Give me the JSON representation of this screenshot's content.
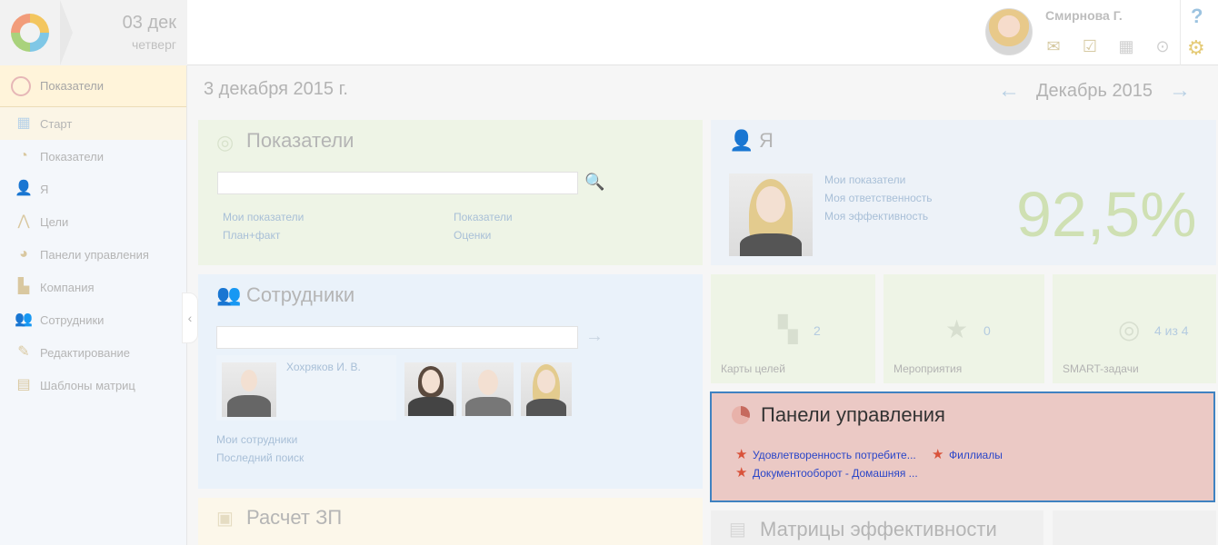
{
  "header": {
    "date_day": "03 дек",
    "date_weekday": "четверг",
    "user_name": "Смирнова Г.",
    "help_label": "?",
    "icons": [
      "mail-icon",
      "tasks-icon",
      "calendar-icon",
      "dropdown-icon"
    ]
  },
  "sidebar": {
    "section_title": "Показатели",
    "items": [
      {
        "label": "Старт",
        "icon": "grid-icon"
      },
      {
        "label": "Показатели",
        "icon": "gauge-icon"
      },
      {
        "label": "Я",
        "icon": "person-icon"
      },
      {
        "label": "Цели",
        "icon": "goals-icon"
      },
      {
        "label": "Панели управления",
        "icon": "piechart-icon"
      },
      {
        "label": "Компания",
        "icon": "factory-icon"
      },
      {
        "label": "Сотрудники",
        "icon": "people-icon"
      },
      {
        "label": "Редактирование",
        "icon": "edit-icon"
      },
      {
        "label": "Шаблоны матриц",
        "icon": "matrix-icon"
      }
    ]
  },
  "main": {
    "date": "3 декабря 2015 г.",
    "month": "Декабрь 2015"
  },
  "panels": {
    "pokazateli": {
      "title": "Показатели",
      "search_value": "",
      "links": [
        "Мои показатели",
        "Показатели",
        "План+факт",
        "Оценки"
      ]
    },
    "ya": {
      "title": "Я",
      "links": [
        "Мои показатели",
        "Моя ответственность",
        "Моя эффективность"
      ],
      "percent": "92,5%"
    },
    "sotrudniki": {
      "title": "Сотрудники",
      "select_value": "",
      "featured_name": "Хохряков И. В.",
      "links": [
        "Мои сотрудники",
        "Последний поиск"
      ]
    },
    "tiles": [
      {
        "label": "Карты целей",
        "count": "2",
        "icon": "map-icon"
      },
      {
        "label": "Мероприятия",
        "count": "0",
        "icon": "star-icon"
      },
      {
        "label": "SMART-задачи",
        "count": "4 из 4",
        "icon": "target-icon"
      }
    ],
    "dashboards": {
      "title": "Панели управления",
      "items": [
        "Удовлетворенность потребите...",
        "Филлиалы",
        "Документооборот - Домашняя ..."
      ]
    },
    "zp": {
      "title": "Расчет ЗП"
    },
    "matrices": {
      "title": "Матрицы эффективности"
    }
  },
  "colors": {
    "dash_link": "#2a46c8",
    "dash_border": "#3f82c1",
    "dash_bg": "#ebc9c5",
    "star": "#d9533b"
  }
}
